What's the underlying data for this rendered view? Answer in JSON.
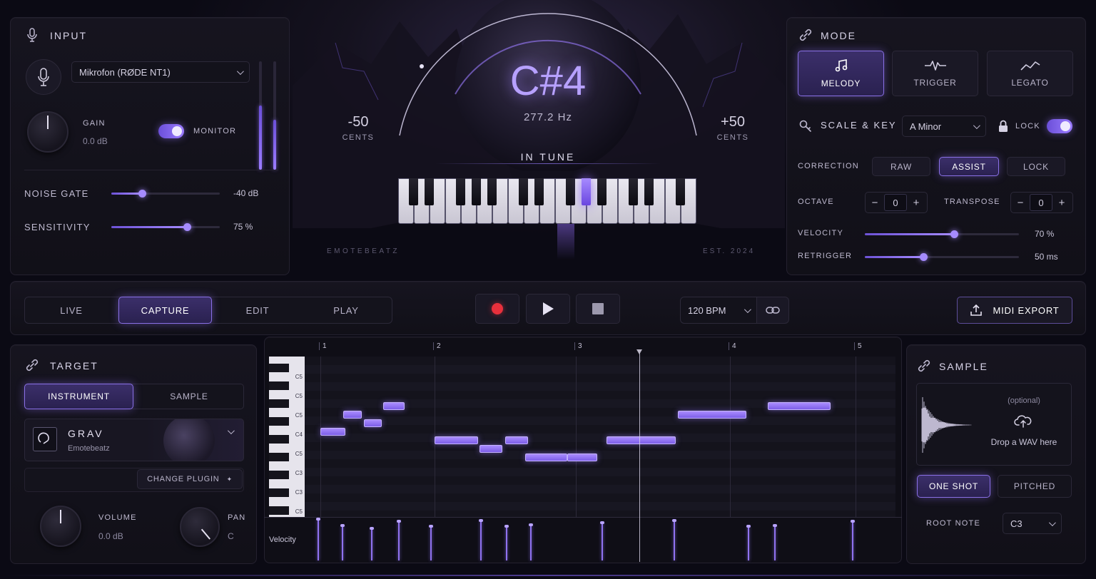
{
  "input": {
    "title": "Input",
    "device": "Mikrofon (RØDE NT1)",
    "gain_label": "GAIN",
    "gain_value": "0.0 dB",
    "monitor_label": "MONITOR",
    "monitor_on": true,
    "noise_gate_label": "NOISE GATE",
    "noise_gate_value": "-40 dB",
    "noise_gate_level": 0.28,
    "sensitivity_label": "SENSITIVITY",
    "sensitivity_value": "75 %",
    "sensitivity_level": 0.7
  },
  "tuner": {
    "note": "C#4",
    "frequency": "277.2 Hz",
    "left_cents": "-50",
    "right_cents": "+50",
    "cents_label": "CENTS",
    "status": "IN TUNE",
    "brand": "EMOTEBEATZ",
    "est": "EST. 2024"
  },
  "mode": {
    "title": "Mode",
    "buttons": [
      {
        "label": "MELODY",
        "icon": "music-note-icon",
        "active": true
      },
      {
        "label": "TRIGGER",
        "icon": "waveform-icon",
        "active": false
      },
      {
        "label": "LEGATO",
        "icon": "curve-icon",
        "active": false
      }
    ],
    "scale_label": "SCALE & KEY",
    "scale_value": "A Minor",
    "lock_label": "LOCK",
    "lock_on": true,
    "correction_label": "CORRECTION",
    "correction_options": [
      "RAW",
      "ASSIST",
      "LOCK"
    ],
    "correction_active": "ASSIST",
    "octave_label": "OCTAVE",
    "octave_value": "0",
    "transpose_label": "TRANSPOSE",
    "transpose_value": "0",
    "velocity_label": "VELOCITY",
    "velocity_value": "70 %",
    "velocity_level": 0.58,
    "retrigger_label": "RETRIGGER",
    "retrigger_value": "50 ms",
    "retrigger_level": 0.38
  },
  "transport": {
    "tabs": [
      "LIVE",
      "CAPTURE",
      "EDIT",
      "PLAY"
    ],
    "active_tab": "CAPTURE",
    "bpm": "120 BPM",
    "midi_export": "MIDI EXPORT"
  },
  "target": {
    "title": "Target",
    "tabs": [
      "INSTRUMENT",
      "SAMPLE"
    ],
    "active_tab": "INSTRUMENT",
    "plugin_name": "GRAV",
    "plugin_vendor": "Emotebeatz",
    "change_plugin": "CHANGE PLUGIN",
    "volume_label": "VOLUME",
    "volume_value": "0.0 dB",
    "pan_label": "PAN",
    "pan_value": "C"
  },
  "piano_roll": {
    "bars": [
      "1",
      "2",
      "3",
      "4",
      "5"
    ],
    "key_labels": [
      "C5",
      "C5",
      "C5",
      "C4",
      "C5",
      "C3",
      "C3",
      "C5"
    ],
    "velocity_label": "Velocity",
    "notes": [
      {
        "bar": 1.0,
        "len": 0.22,
        "row": 4
      },
      {
        "bar": 1.2,
        "len": 0.16,
        "row": 2
      },
      {
        "bar": 1.38,
        "len": 0.16,
        "row": 3
      },
      {
        "bar": 1.55,
        "len": 0.19,
        "row": 1
      },
      {
        "bar": 2.0,
        "len": 0.31,
        "row": 5
      },
      {
        "bar": 2.32,
        "len": 0.16,
        "row": 6
      },
      {
        "bar": 2.5,
        "len": 0.16,
        "row": 5
      },
      {
        "bar": 2.64,
        "len": 0.3,
        "row": 7
      },
      {
        "bar": 2.94,
        "len": 0.2,
        "row": 7
      },
      {
        "bar": 3.2,
        "len": 0.45,
        "row": 5
      },
      {
        "bar": 3.66,
        "len": 0.47,
        "row": 2
      },
      {
        "bar": 4.3,
        "len": 0.5,
        "row": 1
      }
    ],
    "velocities": [
      1.0,
      0.85,
      0.78,
      0.95,
      0.82,
      0.97,
      0.82,
      0.86,
      0.92,
      0.96,
      0.82,
      0.85,
      0.95
    ],
    "playhead_bar": 3.41
  },
  "sample": {
    "title": "Sample",
    "optional": "(optional)",
    "drop_text": "Drop a WAV here",
    "mode_options": [
      "ONE SHOT",
      "PITCHED"
    ],
    "active_mode": "ONE SHOT",
    "root_note_label": "ROOT NOTE",
    "root_note_value": "C3"
  },
  "colors": {
    "accent": "#9b7cff",
    "record": "#e8303c"
  }
}
